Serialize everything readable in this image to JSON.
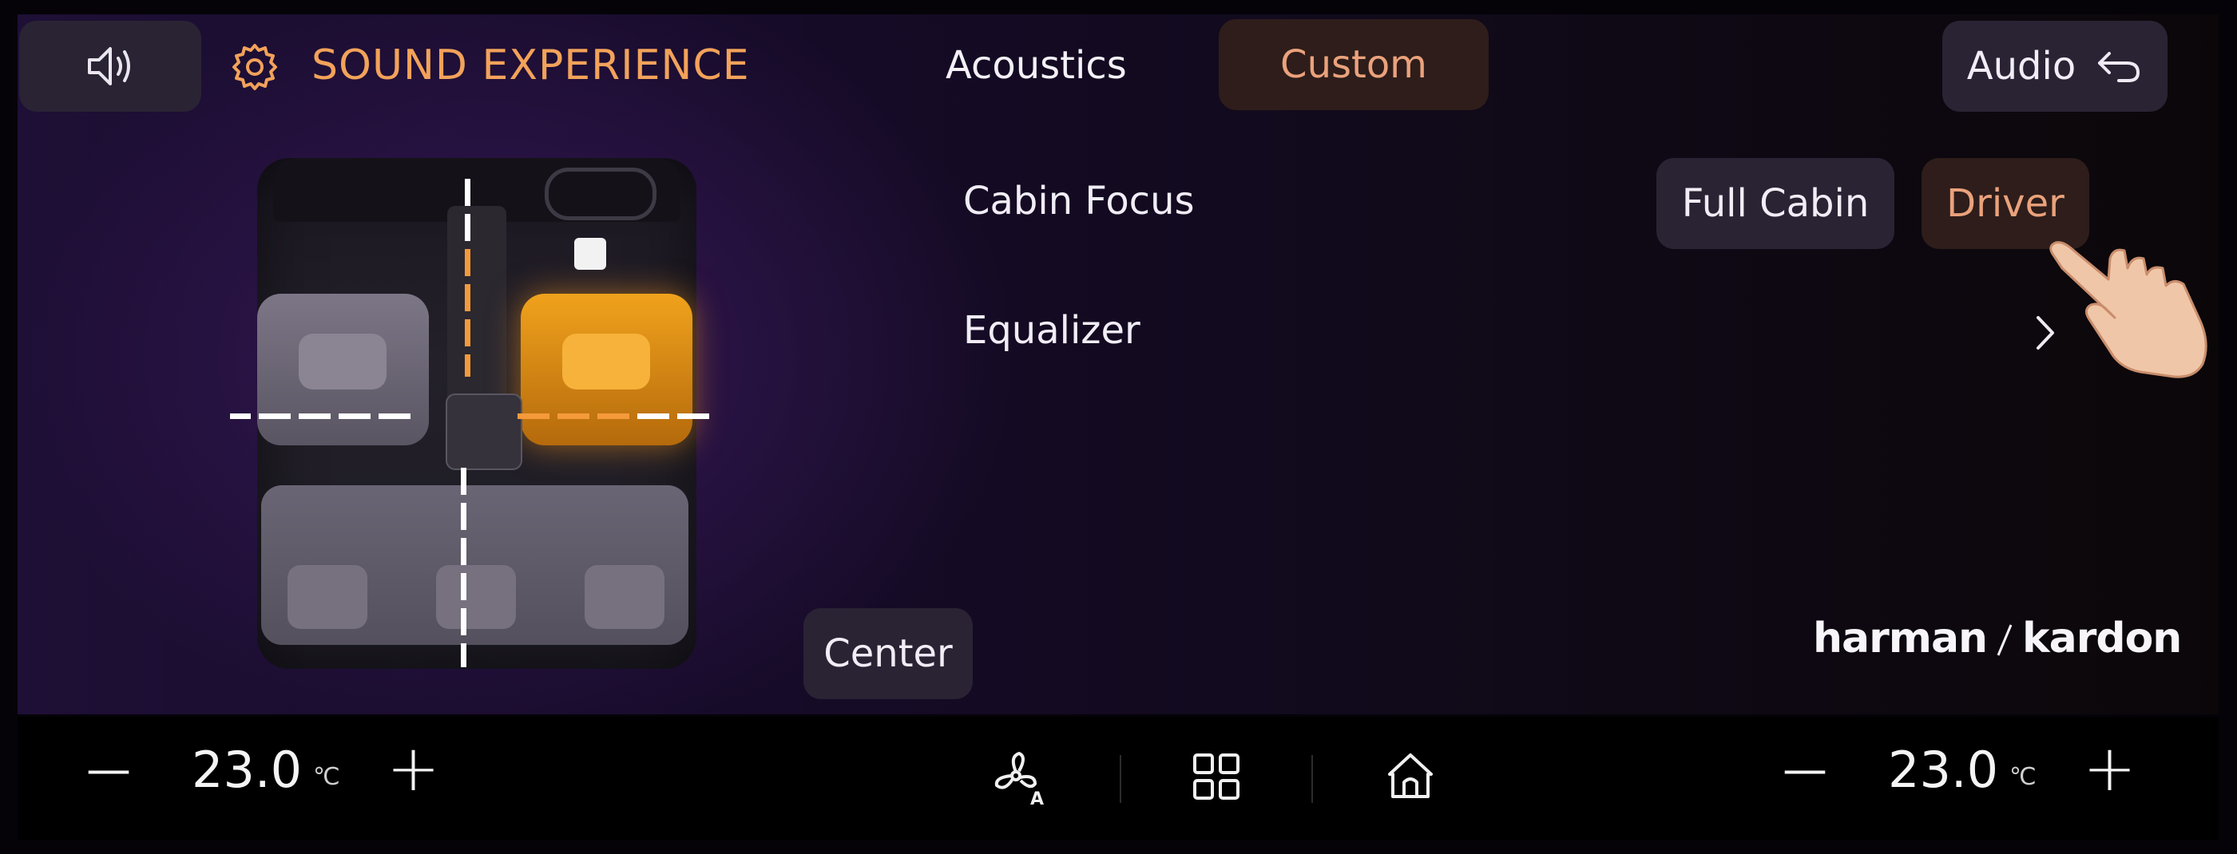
{
  "header": {
    "title": "SOUND EXPERIENCE",
    "tabs": [
      {
        "label": "Acoustics",
        "active": false
      },
      {
        "label": "Custom",
        "active": true
      }
    ],
    "audio_label": "Audio"
  },
  "settings": {
    "cabin_focus_label": "Cabin Focus",
    "cabin_focus_options": [
      "Full Cabin",
      "Driver"
    ],
    "cabin_focus_selected": "Driver",
    "equalizer_label": "Equalizer"
  },
  "soundstage": {
    "center_label": "Center"
  },
  "brand": {
    "name_left": "harman",
    "name_right": "kardon"
  },
  "climate": {
    "left_temp": "23.0",
    "right_temp": "23.0",
    "unit": "℃",
    "minus": "—",
    "plus": "+"
  },
  "icons": [
    "speaker-icon",
    "gear-icon",
    "back-arrow-icon",
    "chevron-right-icon",
    "fan-auto-icon",
    "apps-grid-icon",
    "home-icon",
    "pointing-hand-icon"
  ],
  "colors": {
    "accent": "#f2a25a",
    "selected_text": "#eaa27c",
    "button_bg": "#2a2334",
    "selected_bg": "#2e1d1a"
  }
}
